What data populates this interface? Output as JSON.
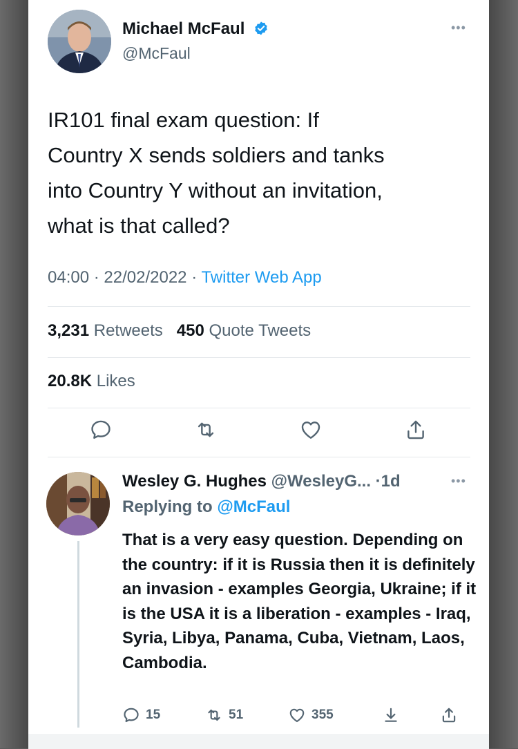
{
  "main_tweet": {
    "author_name": "Michael McFaul",
    "handle": "@McFaul",
    "text": "IR101 final exam question: If\nCountry X sends soldiers and tanks\ninto Country Y without an invitation,\nwhat is that called?",
    "time": "04:00",
    "date": "22/02/2022",
    "source": "Twitter Web App",
    "retweets_count": "3,231",
    "retweets_label": "Retweets",
    "quote_count": "450",
    "quote_label": "Quote Tweets",
    "likes_count": "20.8K",
    "likes_label": "Likes"
  },
  "reply": {
    "author_name": "Wesley G. Hughes",
    "handle": "@WesleyG...",
    "age": "1d",
    "replying_label": "Replying to",
    "replying_to": "@McFaul",
    "text": "That is a very easy question. Depending on the country: if it is Russia then it is definitely an invasion - examples Georgia, Ukraine; if it is the USA it is a liberation - examples - Iraq, Syria, Libya, Panama, Cuba, Vietnam, Laos, Cambodia.",
    "replies": "15",
    "retweets": "51",
    "likes": "355"
  },
  "icons": {
    "verified": "verified-badge-icon",
    "more": "more-icon",
    "reply": "reply-icon",
    "retweet": "retweet-icon",
    "like": "heart-icon",
    "share": "share-icon",
    "download": "download-icon"
  },
  "colors": {
    "accent": "#1d9bf0",
    "muted": "#536471",
    "text": "#0f1419"
  }
}
